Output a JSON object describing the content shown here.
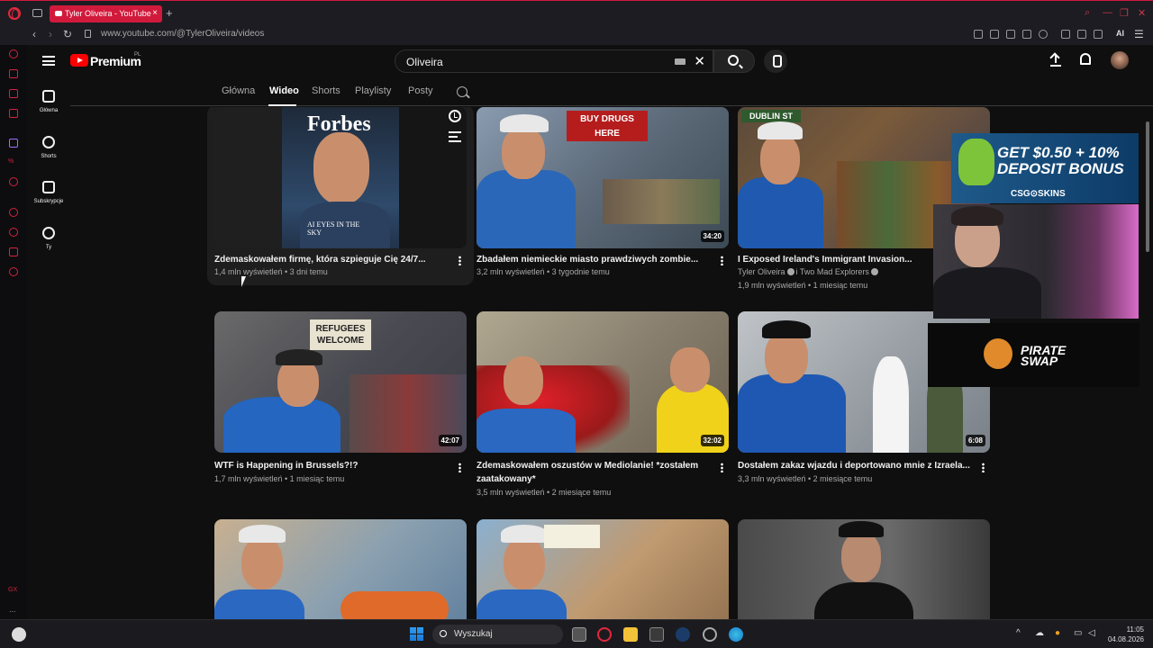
{
  "browser": {
    "tab_title": "Tyler Oliveira - YouTube",
    "url": "www.youtube.com/@TylerOliveira/videos",
    "ai_label": "AI"
  },
  "opera_sidebar": {
    "gx_label": "GX",
    "more": "..."
  },
  "header": {
    "brand": "Premium",
    "region": "PL",
    "search_value": "Oliveira"
  },
  "sidebar": {
    "items": [
      {
        "label": "Główna",
        "icon": "home-icon"
      },
      {
        "label": "Shorts",
        "icon": "shorts-icon"
      },
      {
        "label": "Subskrypcje",
        "icon": "subscriptions-icon"
      },
      {
        "label": "Ty",
        "icon": "account-icon"
      }
    ]
  },
  "channel_tabs": [
    "Główna",
    "Wideo",
    "Shorts",
    "Playlisty",
    "Posty"
  ],
  "active_tab": "Wideo",
  "videos": [
    {
      "title": "Zdemaskowałem firmę, która szpieguje Cię 24/7...",
      "meta": "1,4 mln wyświetleń • 3 dni temu",
      "thumb_headline": "Forbes",
      "thumb_sub": "AI EYES IN THE SKY"
    },
    {
      "title": "Zbadałem niemieckie miasto prawdziwych zombie...",
      "meta": "3,2 mln wyświetleń • 3 tygodnie temu",
      "duration": "34:20",
      "thumb_sign": "BUY DRUGS HERE"
    },
    {
      "title": "I Exposed Ireland's Immigrant Invasion...",
      "channel": "Tyler Oliveira",
      "channel2": "i Two Mad Explorers",
      "meta": "1,9 mln wyświetleń • 1 miesiąc temu",
      "thumb_sign": "DUBLIN ST"
    },
    {
      "title": "WTF is Happening in Brussels?!?",
      "meta": "1,7 mln wyświetleń • 1 miesiąc temu",
      "duration": "42:07",
      "thumb_sign": "REFUGEES WELCOME"
    },
    {
      "title": "Zdemaskowałem oszustów w Mediolanie! *zostałem zaatakowany*",
      "meta": "3,5 mln wyświetleń • 2 miesiące temu",
      "duration": "32:02"
    },
    {
      "title": "Dostałem zakaz wjazdu i deportowano mnie z Izraela...",
      "meta": "3,3 mln wyświetleń • 2 miesiące temu",
      "duration": "6:08"
    },
    {
      "title": "",
      "meta": ""
    },
    {
      "title": "",
      "meta": ""
    },
    {
      "title": "",
      "meta": ""
    }
  ],
  "overlay": {
    "ad_text_line1": "GET $0.50 + 10%",
    "ad_text_line2": "DEPOSIT BONUS",
    "ad_brand": "CSG⊙SKINS",
    "sponsor_line1": "PIRATE",
    "sponsor_line2": "SWAP"
  },
  "taskbar": {
    "search_placeholder": "Wyszukaj",
    "time": "11:05",
    "date": "04.08.2026"
  },
  "colors": {
    "accent": "#ff0000",
    "opera_red": "#d11a3b",
    "bg": "#0f0f0f"
  }
}
